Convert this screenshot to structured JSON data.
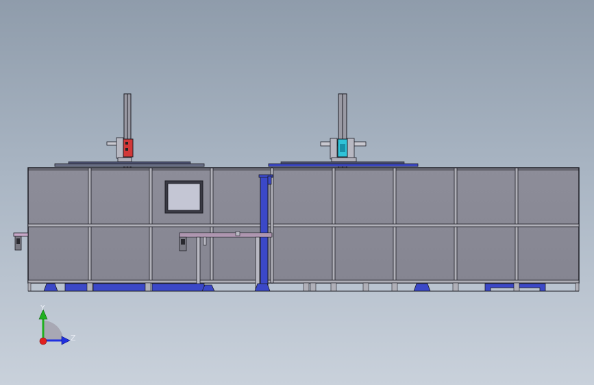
{
  "app": {
    "title": ""
  },
  "colors": {
    "background_top": "#8f9cab",
    "background_bottom": "#c9d1db",
    "panel_fill": "#8a8a96",
    "frame": "#1b1b22",
    "accent_blue": "#3b48c8",
    "gripper_red": "#d23838",
    "gripper_cyan": "#2fc3d8",
    "axis_x": "#e02020",
    "axis_y": "#20b020",
    "axis_z": "#2030e0"
  },
  "icons": [
    "coordinate-triad-icon"
  ],
  "triad": {
    "y_label": "Y",
    "z_label": "Z"
  }
}
